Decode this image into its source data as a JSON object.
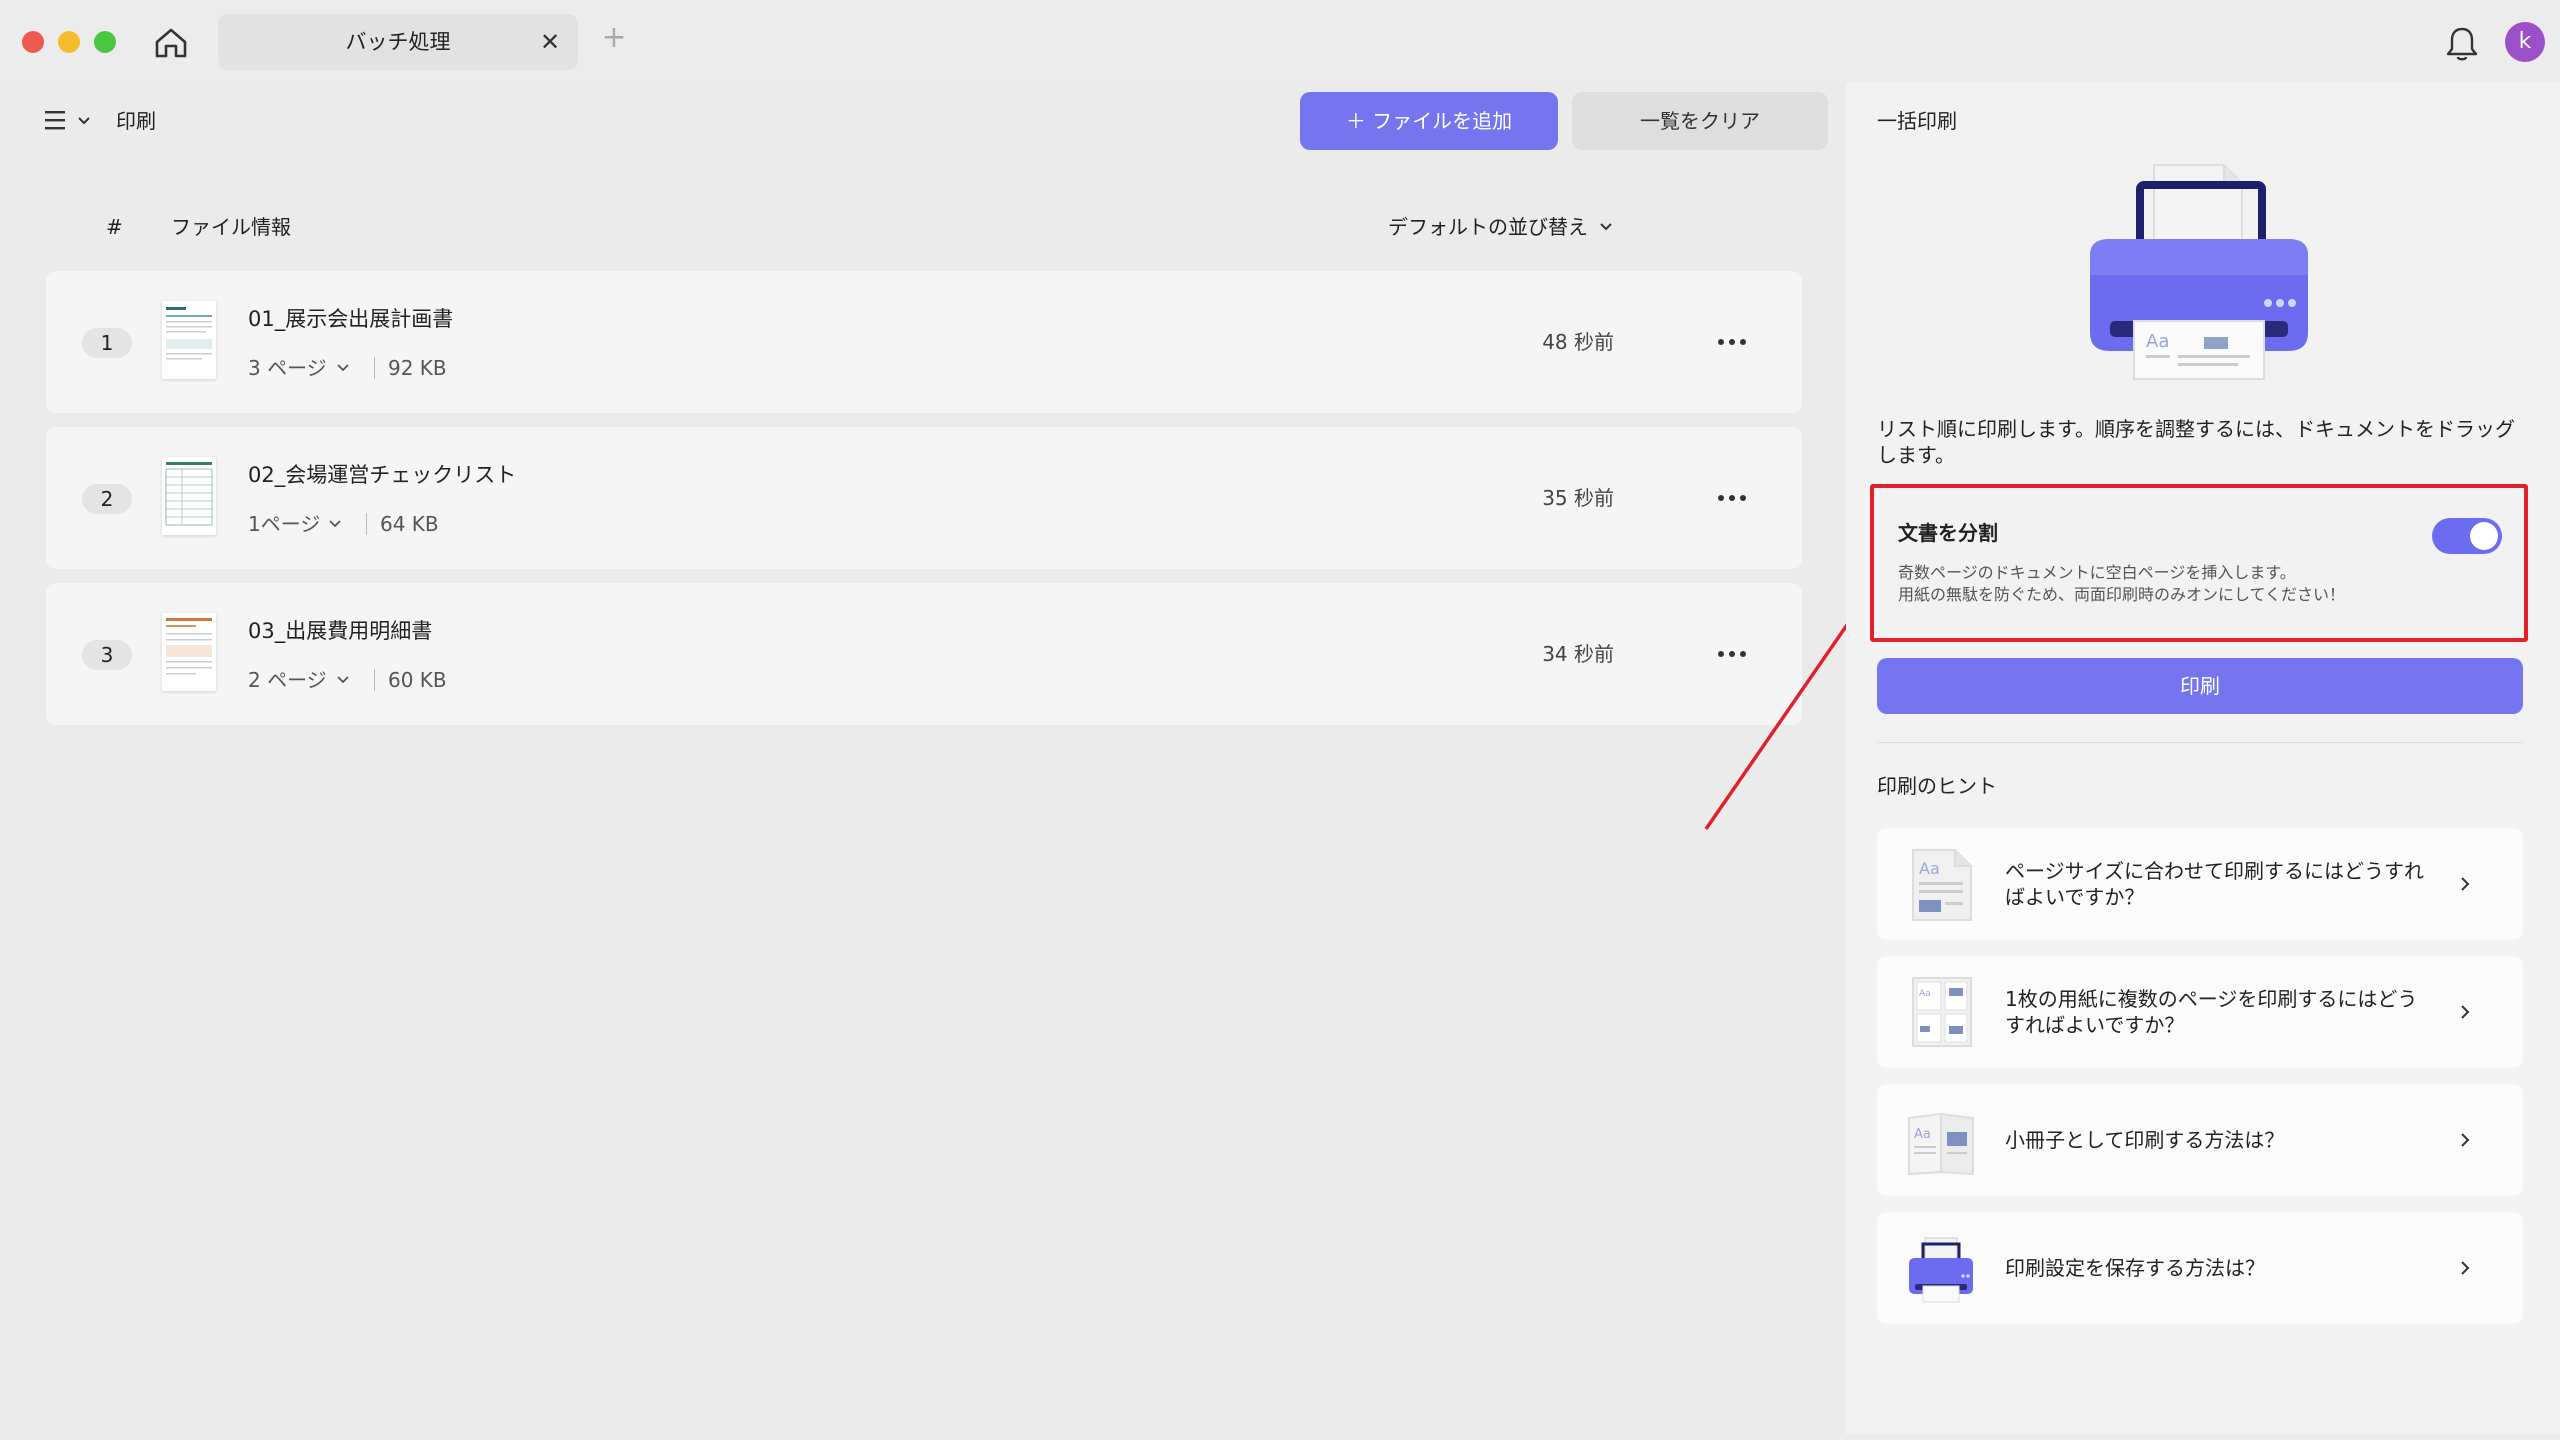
{
  "titlebar": {
    "tab_label": "バッチ処理",
    "avatar_letter": "k"
  },
  "toolbar": {
    "breadcrumb": "印刷",
    "add_file_label": "＋ ファイルを追加",
    "clear_list_label": "一覧をクリア"
  },
  "table": {
    "col_number": "#",
    "col_info": "ファイル情報",
    "sort_label": "デフォルトの並び替え",
    "rows": [
      {
        "num": "1",
        "name": "01_展示会出展計画書",
        "pages": "3 ページ",
        "size": "92 KB",
        "time": "48 秒前"
      },
      {
        "num": "2",
        "name": "02_会場運営チェックリスト",
        "pages": "1ページ",
        "size": "64 KB",
        "time": "35 秒前"
      },
      {
        "num": "3",
        "name": "03_出展費用明細書",
        "pages": "2 ページ",
        "size": "60 KB",
        "time": "34 秒前"
      }
    ]
  },
  "panel": {
    "title": "一括印刷",
    "description": "リスト順に印刷します。順序を調整するには、ドキュメントをドラッグします。",
    "split": {
      "title": "文書を分割",
      "desc_line1": "奇数ページのドキュメントに空白ページを挿入します。",
      "desc_line2": "用紙の無駄を防ぐため、両面印刷時のみオンにしてください！",
      "enabled": true
    },
    "print_label": "印刷",
    "tips_title": "印刷のヒント",
    "tips": [
      {
        "text": "ページサイズに合わせて印刷するにはどうすればよいですか？"
      },
      {
        "text": "1枚の用紙に複数のページを印刷するにはどうすればよいですか？"
      },
      {
        "text": "小冊子として印刷する方法は？"
      },
      {
        "text": "印刷設定を保存する方法は？"
      }
    ]
  },
  "colors": {
    "accent": "#7575f0",
    "highlight": "#e0202a",
    "avatar": "#9b4fc8"
  }
}
